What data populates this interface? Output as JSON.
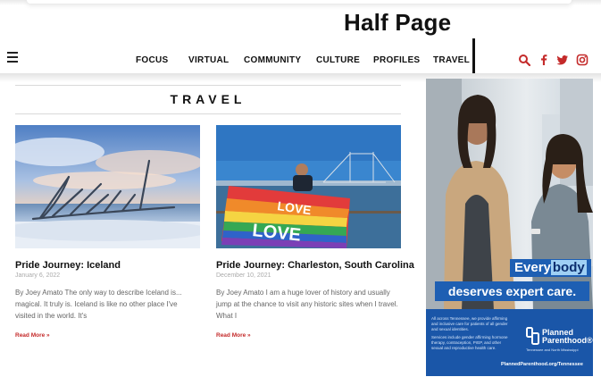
{
  "annotation": {
    "label": "Half Page"
  },
  "nav": {
    "items": [
      "FOCUS",
      "VIRTUAL",
      "COMMUNITY",
      "CULTURE",
      "PROFILES",
      "TRAVEL"
    ],
    "icons": [
      "search-icon",
      "facebook-icon",
      "twitter-icon",
      "instagram-icon"
    ],
    "accent_color": "#c42a2a"
  },
  "section": {
    "title": "TRAVEL"
  },
  "articles": [
    {
      "title": "Pride Journey: Iceland",
      "date": "January 6, 2022",
      "excerpt": "By Joey Amato The only way to describe Iceland is... magical. It truly is. Iceland is like no other place I've visited in the world. It's",
      "read_more": "Read More »"
    },
    {
      "title": "Pride Journey: Charleston, South Carolina",
      "date": "December 10, 2021",
      "excerpt": "By Joey Amato I am a huge lover of history and usually jump at the chance to visit any historic sites when I travel. What I",
      "read_more": "Read More »"
    }
  ],
  "ad": {
    "every": "Every",
    "body": "body",
    "deserves": "deserves expert care.",
    "small_print_1": "All across Tennessee, we provide affirming and inclusive care for patients of all gender and sexual identities.",
    "small_print_2": "Services include gender affirming hormone therapy, contraception, PrEP, and other sexual and reproductive health care.",
    "logo_line1": "Planned",
    "logo_line2": "Parenthood®",
    "logo_sub": "Tennessee and North Mississippi",
    "url": "PlannedParenthood.org/Tennessee",
    "brand_color": "#1e5fb3"
  }
}
